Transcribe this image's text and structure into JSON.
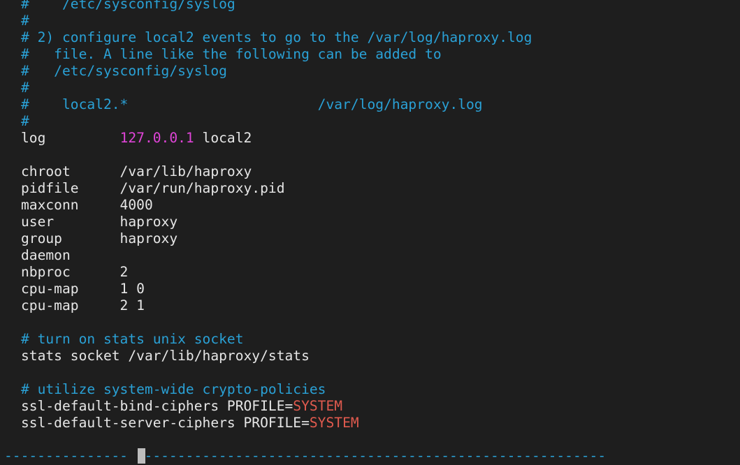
{
  "editor": {
    "lines": [
      {
        "segments": [
          {
            "text": "#    /etc/sysconfig/syslog",
            "style": "comment"
          }
        ]
      },
      {
        "segments": [
          {
            "text": "#",
            "style": "comment"
          }
        ]
      },
      {
        "segments": [
          {
            "text": "# 2) configure local2 events to go to the /var/log/haproxy.log",
            "style": "comment"
          }
        ]
      },
      {
        "segments": [
          {
            "text": "#   file. A line like the following can be added to",
            "style": "comment"
          }
        ]
      },
      {
        "segments": [
          {
            "text": "#   /etc/sysconfig/syslog",
            "style": "comment"
          }
        ]
      },
      {
        "segments": [
          {
            "text": "#",
            "style": "comment"
          }
        ]
      },
      {
        "segments": [
          {
            "text": "#    local2.*                       /var/log/haproxy.log",
            "style": "comment"
          }
        ]
      },
      {
        "segments": [
          {
            "text": "#",
            "style": "comment"
          }
        ]
      },
      {
        "segments": [
          {
            "text": "log         ",
            "style": "plain"
          },
          {
            "text": "127.0.0.1",
            "style": "ip"
          },
          {
            "text": " local2",
            "style": "plain"
          }
        ]
      },
      {
        "segments": [
          {
            "text": "",
            "style": "plain"
          }
        ]
      },
      {
        "segments": [
          {
            "text": "chroot      /var/lib/haproxy",
            "style": "plain"
          }
        ]
      },
      {
        "segments": [
          {
            "text": "pidfile     /var/run/haproxy.pid",
            "style": "plain"
          }
        ]
      },
      {
        "segments": [
          {
            "text": "maxconn     4000",
            "style": "plain"
          }
        ]
      },
      {
        "segments": [
          {
            "text": "user        haproxy",
            "style": "plain"
          }
        ]
      },
      {
        "segments": [
          {
            "text": "group       haproxy",
            "style": "plain"
          }
        ]
      },
      {
        "segments": [
          {
            "text": "daemon",
            "style": "plain"
          }
        ]
      },
      {
        "segments": [
          {
            "text": "nbproc      2",
            "style": "plain"
          }
        ]
      },
      {
        "segments": [
          {
            "text": "cpu-map     1 0",
            "style": "plain"
          }
        ]
      },
      {
        "segments": [
          {
            "text": "cpu-map     2 1",
            "style": "plain"
          }
        ]
      },
      {
        "segments": [
          {
            "text": "",
            "style": "plain"
          }
        ]
      },
      {
        "segments": [
          {
            "text": "# turn on stats unix socket",
            "style": "comment"
          }
        ]
      },
      {
        "segments": [
          {
            "text": "stats socket /var/lib/haproxy/stats",
            "style": "plain"
          }
        ]
      },
      {
        "segments": [
          {
            "text": "",
            "style": "plain"
          }
        ]
      },
      {
        "segments": [
          {
            "text": "# utilize system-wide crypto-policies",
            "style": "comment"
          }
        ]
      },
      {
        "segments": [
          {
            "text": "ssl-default-bind-ciphers PROFILE=",
            "style": "plain"
          },
          {
            "text": "SYSTEM",
            "style": "kw"
          }
        ]
      },
      {
        "segments": [
          {
            "text": "ssl-default-server-ciphers PROFILE=",
            "style": "plain"
          },
          {
            "text": "SYSTEM",
            "style": "kw"
          }
        ]
      }
    ]
  },
  "statusbar": {
    "left_dashes": "---------------",
    "right_dashes": "---------------------------------------------------------"
  },
  "colors": {
    "background": "#1e1e1e",
    "text": "#e6e6e6",
    "comment": "#2aa1d6",
    "ip_literal": "#e044d8",
    "keyword": "#e05a4e",
    "cursor": "#bdbdbd"
  }
}
